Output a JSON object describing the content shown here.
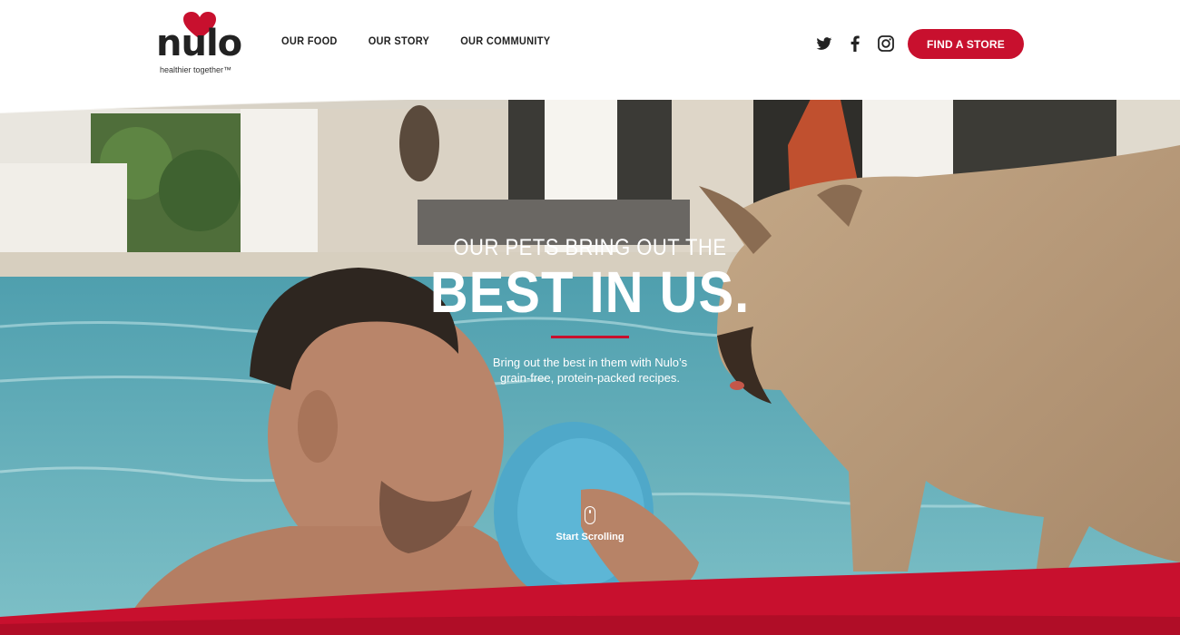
{
  "brand": {
    "name": "nulo",
    "tagline": "healthier together™",
    "accent": "#c8102e"
  },
  "nav": {
    "items": [
      "OUR FOOD",
      "OUR STORY",
      "OUR COMMUNITY"
    ]
  },
  "social": {
    "icons": [
      "twitter-icon",
      "facebook-icon",
      "instagram-icon"
    ]
  },
  "cta": {
    "label": "FIND A STORE"
  },
  "hero": {
    "pretitle": "OUR PETS BRING OUT THE",
    "title": "BEST IN US.",
    "subtitle": "Bring out the best in them with Nulo’s grain-free, protein-packed recipes."
  },
  "scroll": {
    "label": "Start Scrolling"
  }
}
